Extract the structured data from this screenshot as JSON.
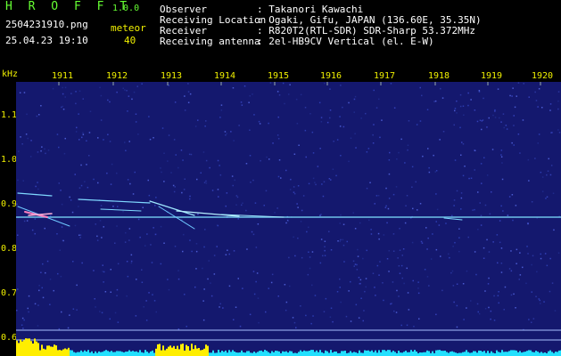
{
  "app": {
    "name": "H R O F F T",
    "version": "1.0.0"
  },
  "file": {
    "filename": "2504231910.png",
    "datetime": "25.04.23 19:10"
  },
  "counter": {
    "label": "meteor",
    "value": "40"
  },
  "info": [
    {
      "label": "Observer",
      "value": ": Takanori Kawachi"
    },
    {
      "label": "Receiving Location",
      "value": ": Ogaki, Gifu, JAPAN (136.60E, 35.35N)"
    },
    {
      "label": "Receiver",
      "value": ": R820T2(RTL-SDR) SDR-Sharp 53.372MHz"
    },
    {
      "label": "Receiving antenna",
      "value": ": 2el-HB9CV Vertical (el. E-W)"
    }
  ],
  "axis": {
    "y_unit": "kHz",
    "x_ticks": [
      "1911",
      "1912",
      "1913",
      "1914",
      "1915",
      "1916",
      "1917",
      "1918",
      "1919",
      "1920"
    ],
    "y_ticks": [
      "1.1",
      "1.0",
      "0.9",
      "0.8",
      "0.7",
      "0.6"
    ]
  },
  "colors": {
    "background": "#14186e",
    "carrier": "#7fe0ff",
    "bar": "#ffee00",
    "bar_low": "#22e0ff"
  }
}
